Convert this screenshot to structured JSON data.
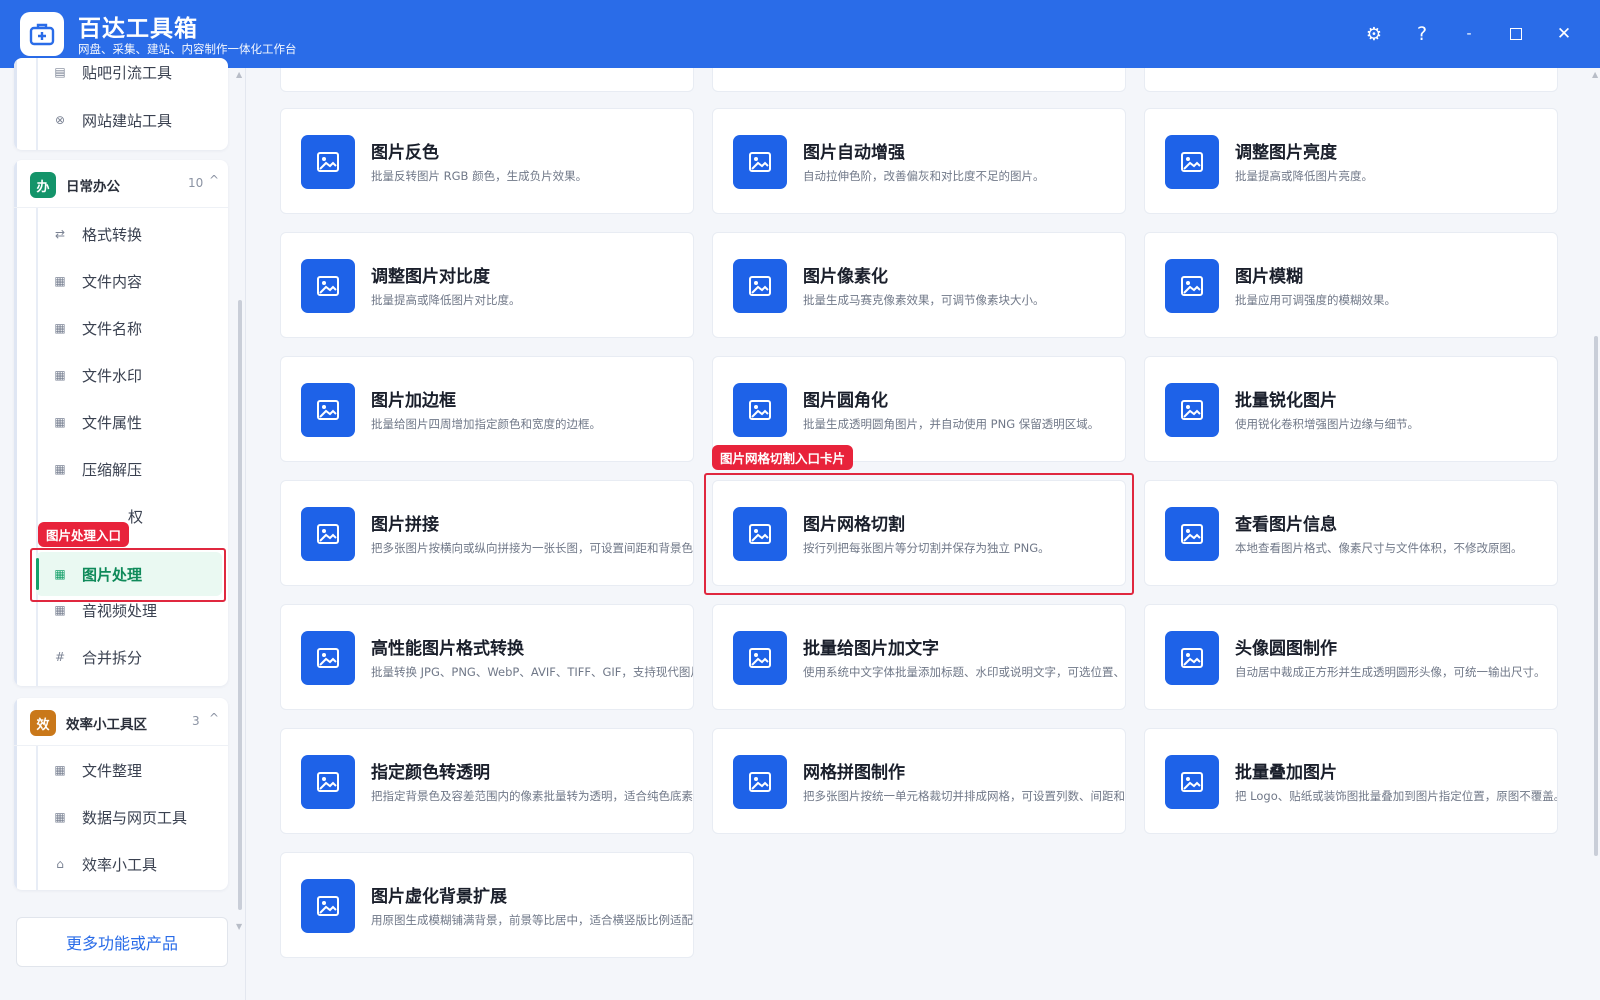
{
  "app": {
    "title": "百达工具箱",
    "subtitle": "网盘、采集、建站、内容制作一体化工作台"
  },
  "window_controls": {
    "settings": "⚙",
    "help": "?",
    "minimize": "‑",
    "close": "✕"
  },
  "sidebar": {
    "top_items": [
      {
        "label": "贴吧引流工具",
        "icon": "doc-icon"
      },
      {
        "label": "网站建站工具",
        "icon": "globe-icon"
      }
    ],
    "categories": [
      {
        "badge": "办",
        "label": "日常办公",
        "count": "10",
        "caret": "^",
        "color": "#14946a"
      },
      {
        "badge": "效",
        "label": "效率小工具区",
        "count": "3",
        "caret": "^",
        "color": "#c9781a"
      }
    ],
    "office_items": [
      {
        "label": "格式转换",
        "icon": "⇄"
      },
      {
        "label": "文件内容",
        "icon": "▦"
      },
      {
        "label": "文件名称",
        "icon": "▦"
      },
      {
        "label": "文件水印",
        "icon": "▦"
      },
      {
        "label": "文件属性",
        "icon": "▦"
      },
      {
        "label": "压缩解压",
        "icon": "▦"
      },
      {
        "label": "权",
        "icon": ""
      },
      {
        "label": "图片处理",
        "icon": "▦"
      },
      {
        "label": "音视频处理",
        "icon": "▦"
      },
      {
        "label": "合并拆分",
        "icon": "#"
      }
    ],
    "efficiency_items": [
      {
        "label": "文件整理",
        "icon": "▦"
      },
      {
        "label": "数据与网页工具",
        "icon": "▦"
      },
      {
        "label": "效率小工具",
        "icon": "⌂"
      }
    ],
    "more_button": "更多功能或产品"
  },
  "tools": [
    {
      "title": "图片反色",
      "desc": "批量反转图片 RGB 颜色，生成负片效果。"
    },
    {
      "title": "图片自动增强",
      "desc": "自动拉伸色阶，改善偏灰和对比度不足的图片。"
    },
    {
      "title": "调整图片亮度",
      "desc": "批量提高或降低图片亮度。"
    },
    {
      "title": "调整图片对比度",
      "desc": "批量提高或降低图片对比度。"
    },
    {
      "title": "图片像素化",
      "desc": "批量生成马赛克像素效果，可调节像素块大小。"
    },
    {
      "title": "图片模糊",
      "desc": "批量应用可调强度的模糊效果。"
    },
    {
      "title": "图片加边框",
      "desc": "批量给图片四周增加指定颜色和宽度的边框。"
    },
    {
      "title": "图片圆角化",
      "desc": "批量生成透明圆角图片，并自动使用 PNG 保留透明区域。"
    },
    {
      "title": "批量锐化图片",
      "desc": "使用锐化卷积增强图片边缘与细节。"
    },
    {
      "title": "图片拼接",
      "desc": "把多张图片按横向或纵向拼接为一张长图，可设置间距和背景色。"
    },
    {
      "title": "图片网格切割",
      "desc": "按行列把每张图片等分切割并保存为独立 PNG。"
    },
    {
      "title": "查看图片信息",
      "desc": "本地查看图片格式、像素尺寸与文件体积，不修改原图。"
    },
    {
      "title": "高性能图片格式转换",
      "desc": "批量转换 JPG、PNG、WebP、AVIF、TIFF、GIF，支持现代图片"
    },
    {
      "title": "批量给图片加文字",
      "desc": "使用系统中文字体批量添加标题、水印或说明文字，可选位置、字"
    },
    {
      "title": "头像圆图制作",
      "desc": "自动居中裁成正方形并生成透明圆形头像，可统一输出尺寸。"
    },
    {
      "title": "指定颜色转透明",
      "desc": "把指定背景色及容差范围内的像素批量转为透明，适合纯色底素材"
    },
    {
      "title": "网格拼图制作",
      "desc": "把多张图片按统一单元格裁切并排成网格，可设置列数、间距和背"
    },
    {
      "title": "批量叠加图片",
      "desc": "把 Logo、贴纸或装饰图批量叠加到图片指定位置，原图不覆盖。"
    },
    {
      "title": "图片虚化背景扩展",
      "desc": "用原图生成模糊铺满背景，前景等比居中，适合横竖版比例适配。"
    }
  ],
  "annotations": {
    "sidebar_label": "图片处理入口",
    "card_label": "图片网格切割入口卡片"
  },
  "colors": {
    "brand": "#2a6ce8",
    "tile": "#1e62e8",
    "active": "#16a06a",
    "annotation": "#e8233b"
  }
}
